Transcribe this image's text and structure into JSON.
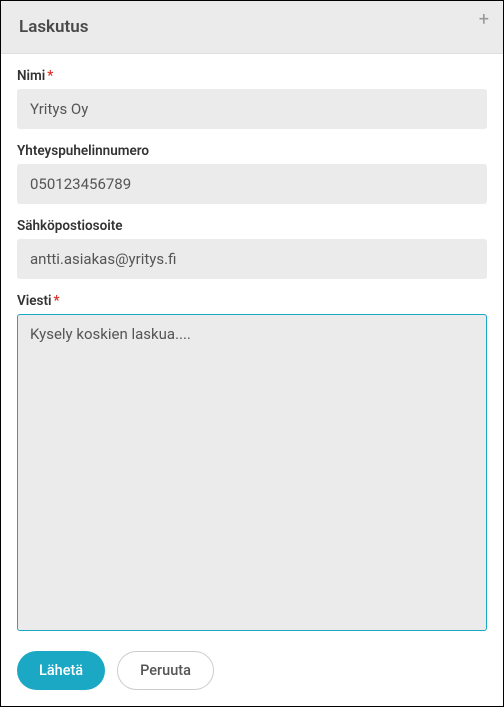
{
  "header": {
    "title": "Laskutus"
  },
  "fields": {
    "name": {
      "label": "Nimi",
      "required": true,
      "value": "Yritys Oy"
    },
    "phone": {
      "label": "Yhteyspuhelinnumero",
      "required": false,
      "value": "050123456789"
    },
    "email": {
      "label": "Sähköpostiosoite",
      "required": false,
      "value": "antti.asiakas@yritys.fi"
    },
    "message": {
      "label": "Viesti",
      "required": true,
      "value": "Kysely koskien laskua...."
    }
  },
  "actions": {
    "submit": "Lähetä",
    "cancel": "Peruuta"
  }
}
